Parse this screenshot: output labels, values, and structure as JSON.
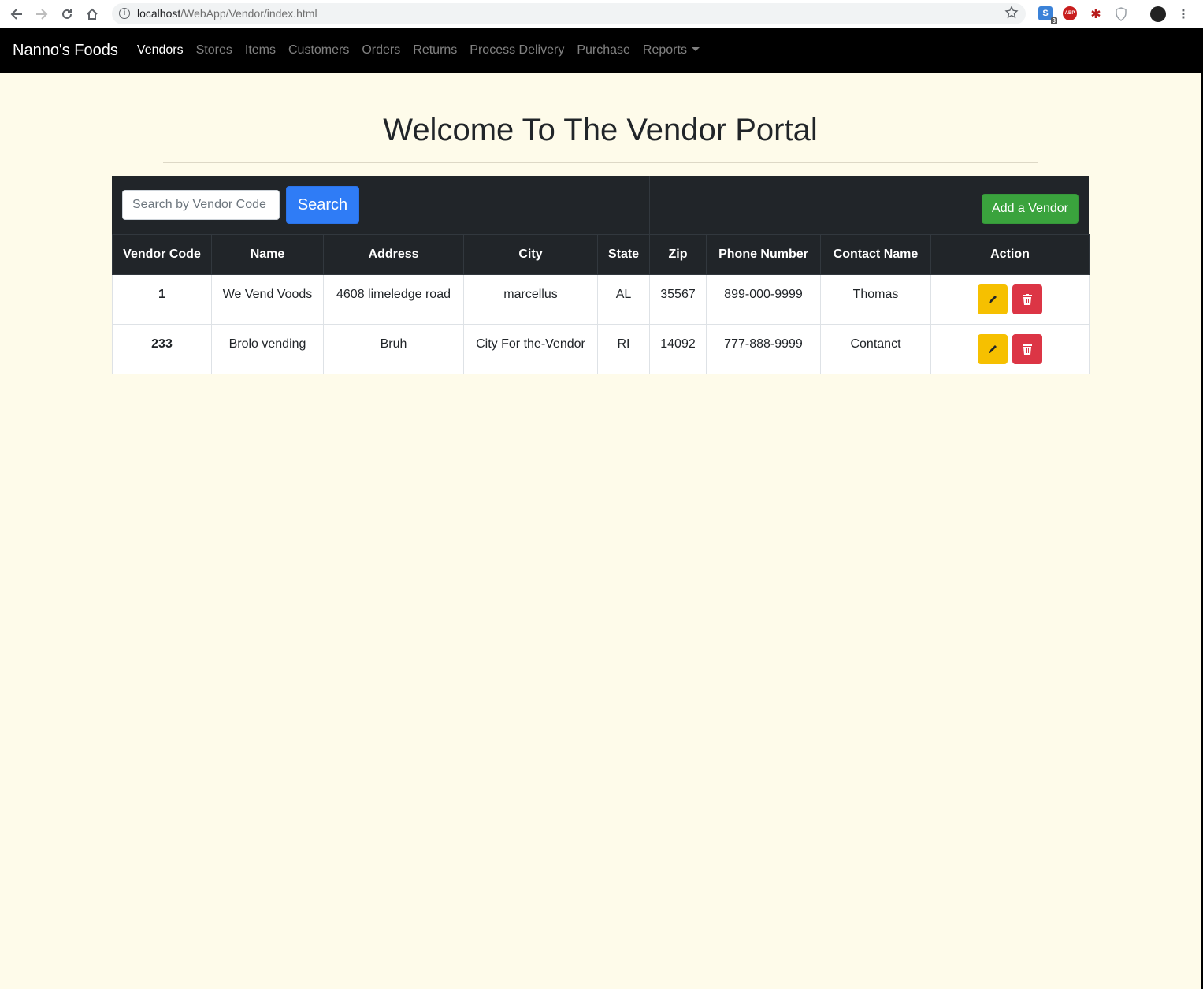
{
  "browser": {
    "url_host": "localhost",
    "url_path": "/WebApp/Vendor/index.html",
    "extension_badge": "3",
    "abp_label": "ABP"
  },
  "navbar": {
    "brand": "Nanno's Foods",
    "links": [
      "Vendors",
      "Stores",
      "Items",
      "Customers",
      "Orders",
      "Returns",
      "Process Delivery",
      "Purchase",
      "Reports"
    ],
    "active": "Vendors"
  },
  "page": {
    "title": "Welcome To The Vendor Portal"
  },
  "toolbar": {
    "search_placeholder": "Search by Vendor Code",
    "search_label": "Search",
    "add_label": "Add a Vendor"
  },
  "table": {
    "headers": [
      "Vendor Code",
      "Name",
      "Address",
      "City",
      "State",
      "Zip",
      "Phone Number",
      "Contact Name",
      "Action"
    ],
    "rows": [
      {
        "code": "1",
        "name": "We Vend Voods",
        "address": "4608 limeledge road",
        "city": "marcellus",
        "state": "AL",
        "zip": "35567",
        "phone": "899-000-9999",
        "contact": "Thomas"
      },
      {
        "code": "233",
        "name": "Brolo vending",
        "address": "Bruh",
        "city": "City For the-Vendor",
        "state": "RI",
        "zip": "14092",
        "phone": "777-888-9999",
        "contact": "Contanct"
      }
    ]
  },
  "colors": {
    "page_bg": "#fefbea",
    "navbar_bg": "#000000",
    "table_dark": "#212529",
    "primary": "#2f7cf6",
    "success": "#3aa33d",
    "warning": "#f6c000",
    "danger": "#dc3545"
  },
  "icons": {
    "edit": "pencil-icon",
    "delete": "trash-icon"
  }
}
